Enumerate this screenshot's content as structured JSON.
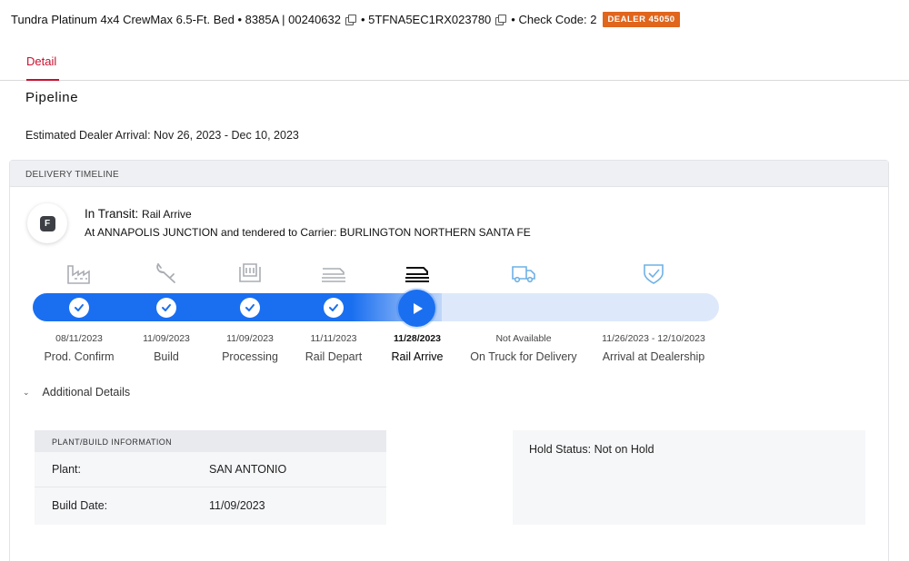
{
  "header": {
    "vehicle": "Tundra Platinum 4x4 CrewMax 6.5-Ft. Bed • 8385A | 00240632",
    "vin": "• 5TFNA5EC1RX023780",
    "check_code": "• Check Code: 2",
    "dealer_badge": "DEALER 45050"
  },
  "tabs": [
    {
      "label": "Detail",
      "active": true
    }
  ],
  "pipeline": {
    "title": "Pipeline",
    "eta": "Estimated Dealer Arrival: Nov 26, 2023 - Dec 10, 2023"
  },
  "timeline": {
    "header": "DELIVERY TIMELINE",
    "status_letter": "F",
    "status_label": "In Transit:",
    "status_sub": "Rail Arrive",
    "status_detail": "At ANNAPOLIS JUNCTION and tendered to Carrier: BURLINGTON NORTHERN SANTA FE",
    "stages": [
      {
        "name": "Prod. Confirm",
        "date": "08/11/2023",
        "state": "done",
        "icon": "factory-icon"
      },
      {
        "name": "Build",
        "date": "11/09/2023",
        "state": "done",
        "icon": "wrench-icon"
      },
      {
        "name": "Processing",
        "date": "11/09/2023",
        "state": "done",
        "icon": "seat-icon"
      },
      {
        "name": "Rail Depart",
        "date": "11/11/2023",
        "state": "done",
        "icon": "railcar-icon"
      },
      {
        "name": "Rail Arrive",
        "date": "11/28/2023",
        "state": "current",
        "icon": "railcar-icon"
      },
      {
        "name": "On Truck for Delivery",
        "date": "Not Available",
        "state": "upcoming",
        "icon": "truck-icon"
      },
      {
        "name": "Arrival at Dealership",
        "date": "11/26/2023 - 12/10/2023",
        "state": "upcoming",
        "icon": "shield-check-icon"
      }
    ],
    "colors": {
      "progress": "#1a6ff0",
      "track": "#dde9fb",
      "done_icon": "#a9adb3",
      "upcoming_icon": "#6fb1e6"
    }
  },
  "additional_details": {
    "label": "Additional Details",
    "plant_info": {
      "header": "PLANT/BUILD INFORMATION",
      "rows": [
        {
          "label": "Plant:",
          "value": "SAN ANTONIO"
        },
        {
          "label": "Build Date:",
          "value": "11/09/2023"
        }
      ]
    },
    "hold_status": "Hold Status: Not on Hold"
  }
}
